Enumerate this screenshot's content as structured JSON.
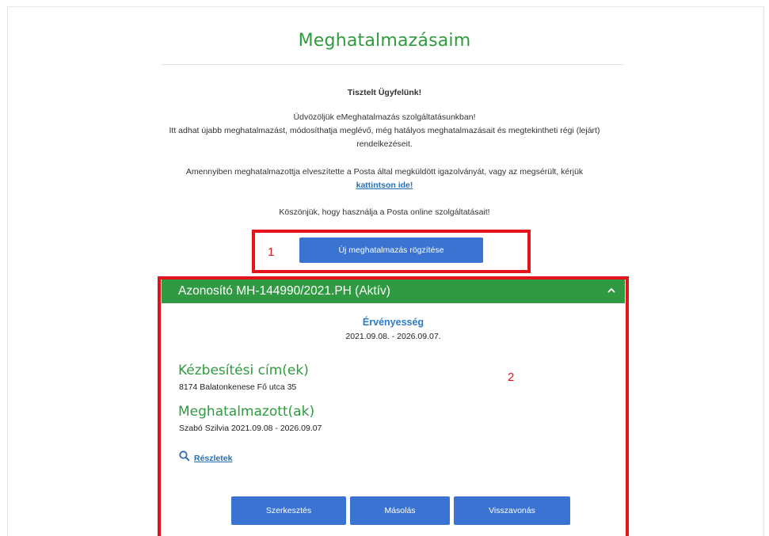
{
  "page": {
    "title": "Meghatalmazásaim"
  },
  "intro": {
    "greeting": "Tisztelt Ügyfelünk!",
    "welcome": "Üdvözöljük eMeghatalmazás szolgáltatásunkban!",
    "description_line1": "Itt adhat újabb meghatalmazást, módosíthatja meglévő, még hatályos meghatalmazásait és megtekintheti régi (lejárt)",
    "description_line2": "rendelkezéseit.",
    "lost_card_text": "Amennyiben meghatalmazottja elveszítette a Posta által megküldött igazolványát, vagy az megsérült, kérjük",
    "lost_card_link": "kattintson ide!",
    "thanks": "Köszönjük, hogy használja a Posta online szolgáltatásait!"
  },
  "new_authorization_button": "Új meghatalmazás rögzítése",
  "annotations": {
    "box1_label": "1",
    "box2_label": "2",
    "color": "#e4121b"
  },
  "authorization": {
    "header": "Azonosító MH-144990/2021.PH (Aktív)",
    "header_icon": "chevron-up-icon",
    "validity_label": "Érvényesség",
    "validity_value": "2021.09.08. - 2026.09.07.",
    "delivery_label": "Kézbesítési cím(ek)",
    "delivery_value": "8174 Balatonkenese Fő utca 35",
    "authorized_label": "Meghatalmazott(ak)",
    "authorized_value": "Szabó Szilvia 2021.09.08 - 2026.09.07",
    "details_icon": "search-icon",
    "details_link": "Részletek",
    "buttons": {
      "edit": "Szerkesztés",
      "copy": "Másolás",
      "revoke": "Visszavonás"
    }
  },
  "colors": {
    "brand_green": "#2f9a41",
    "button_blue": "#3a73d1",
    "link_blue": "#2a6fb0"
  }
}
